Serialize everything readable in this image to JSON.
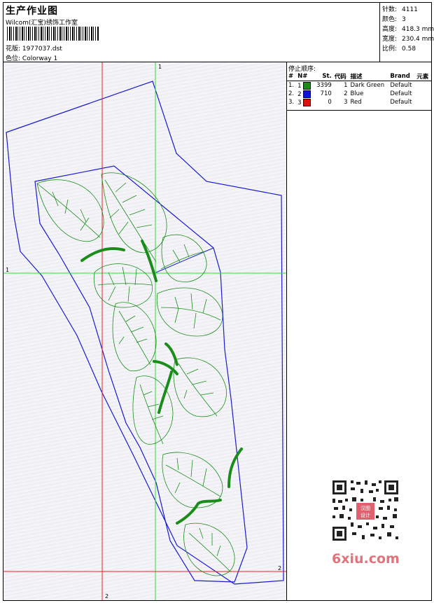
{
  "header": {
    "title": "生产作业图",
    "company": "Wilcom(汇宝)绣饰工作室",
    "design_label": "花版:",
    "design_value": "1977037.dst",
    "colorway_label": "色位:",
    "colorway_value": "Colorway 1"
  },
  "stats": [
    {
      "label": "针数:",
      "value": "4111"
    },
    {
      "label": "颜色:",
      "value": "3"
    },
    {
      "label": "高度:",
      "value": "418.3 mm"
    },
    {
      "label": "宽度:",
      "value": "230.4 mm"
    },
    {
      "label": "比例:",
      "value": "0.58"
    }
  ],
  "stop_panel": {
    "title": "停止顺序:",
    "columns": [
      "#",
      "N#",
      "St.",
      "代码",
      "描述",
      "Brand",
      "元素"
    ],
    "rows": [
      {
        "idx": "1.",
        "n": "1",
        "color": "#1a8c1a",
        "st": "3399",
        "code": "1",
        "desc": "Dark Green",
        "brand": "Default",
        "elem": ""
      },
      {
        "idx": "2.",
        "n": "2",
        "color": "#1010e0",
        "st": "710",
        "code": "2",
        "desc": "Blue",
        "brand": "Default",
        "elem": ""
      },
      {
        "idx": "3.",
        "n": "3",
        "color": "#e01010",
        "st": "0",
        "code": "3",
        "desc": "Red",
        "brand": "Default",
        "elem": ""
      }
    ]
  },
  "guides": {
    "green_v": "1",
    "green_h": "1",
    "red_h": "2",
    "red_v": "2"
  },
  "watermark": {
    "seal_text": "汉图设计",
    "site": "6xiu.com"
  },
  "colors": {
    "outline": "#1a1ad0",
    "embroidery": "#1a8c1a",
    "guide_green": "#33dd33",
    "guide_red": "#ee2222"
  }
}
